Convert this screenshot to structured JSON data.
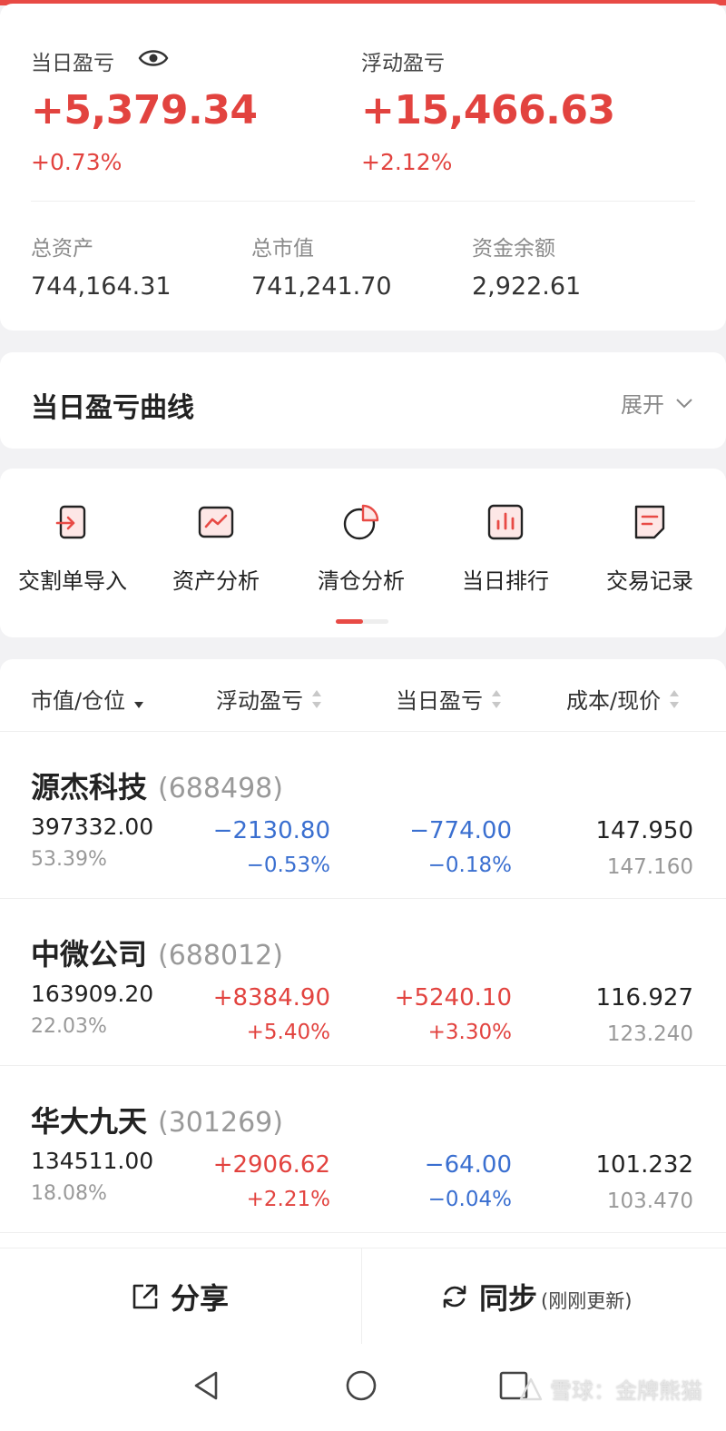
{
  "summary": {
    "daily_pl_label": "当日盈亏",
    "daily_pl_value": "+5,379.34",
    "daily_pl_pct": "+0.73%",
    "float_pl_label": "浮动盈亏",
    "float_pl_value": "+15,466.63",
    "float_pl_pct": "+2.12%",
    "total_assets_label": "总资产",
    "total_assets_value": "744,164.31",
    "market_value_label": "总市值",
    "market_value_value": "741,241.70",
    "cash_label": "资金余额",
    "cash_value": "2,922.61"
  },
  "curve": {
    "title": "当日盈亏曲线",
    "expand_label": "展开"
  },
  "tools": [
    {
      "label": "交割单导入",
      "icon": "import-icon"
    },
    {
      "label": "资产分析",
      "icon": "trend-chart-icon"
    },
    {
      "label": "清仓分析",
      "icon": "pie-chart-icon"
    },
    {
      "label": "当日排行",
      "icon": "bar-chart-icon"
    },
    {
      "label": "交易记录",
      "icon": "document-icon"
    }
  ],
  "table": {
    "headers": [
      "市值/仓位",
      "浮动盈亏",
      "当日盈亏",
      "成本/现价"
    ],
    "rows": [
      {
        "name": "源杰科技",
        "code": "(688498)",
        "market_value": "397332.00",
        "position": "53.39%",
        "float_pl": "−2130.80",
        "float_pct": "−0.53%",
        "daily_pl": "−774.00",
        "daily_pct": "−0.18%",
        "cost": "147.950",
        "price": "147.160"
      },
      {
        "name": "中微公司",
        "code": "(688012)",
        "market_value": "163909.20",
        "position": "22.03%",
        "float_pl": "+8384.90",
        "float_pct": "+5.40%",
        "daily_pl": "+5240.10",
        "daily_pct": "+3.30%",
        "cost": "116.927",
        "price": "123.240"
      },
      {
        "name": "华大九天",
        "code": "(301269)",
        "market_value": "134511.00",
        "position": "18.08%",
        "float_pl": "+2906.62",
        "float_pct": "+2.21%",
        "daily_pl": "−64.00",
        "daily_pct": "−0.04%",
        "cost": "101.232",
        "price": "103.470"
      }
    ]
  },
  "actions": {
    "share_label": "分享",
    "sync_label": "同步",
    "sync_note": "(刚刚更新)"
  },
  "watermark": "雪球：金牌熊猫",
  "colors": {
    "up": "#e2433f",
    "down": "#3a6fd0",
    "accent": "#e84a45"
  }
}
